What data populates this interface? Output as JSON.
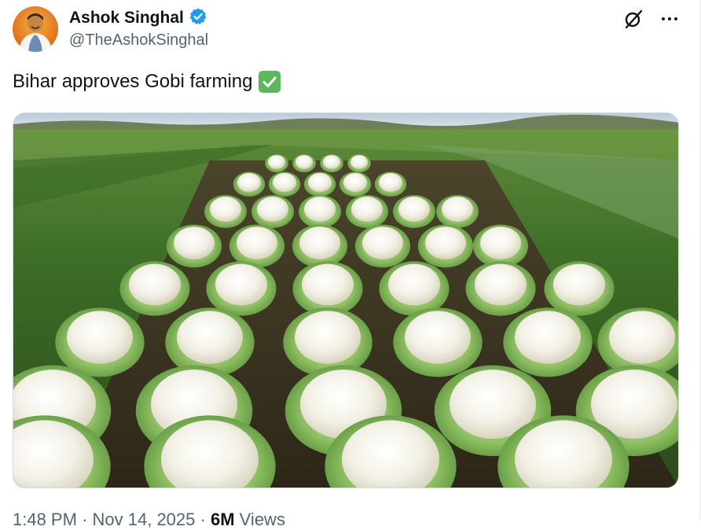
{
  "author": {
    "display_name": "Ashok Singhal",
    "handle": "@TheAshokSinghal",
    "verified": true,
    "avatar_icon": "profile-photo"
  },
  "actions": {
    "grok_icon": "grok-icon",
    "more_icon": "more-horizontal-icon"
  },
  "tweet": {
    "text": "Bihar approves Gobi farming",
    "emoji": "white-heavy-check-mark-emoji"
  },
  "media": {
    "kind": "photo",
    "subject": "cauliflower-field"
  },
  "meta": {
    "time": "1:48 PM",
    "separator1": "·",
    "date": "Nov 14, 2025",
    "separator2": "·",
    "views_count": "6M",
    "views_label": "Views"
  },
  "colors": {
    "verified_badge": "#1d9bf0",
    "text_primary": "#0f1419",
    "text_secondary": "#536471",
    "check_emoji": "#5cb85c"
  }
}
